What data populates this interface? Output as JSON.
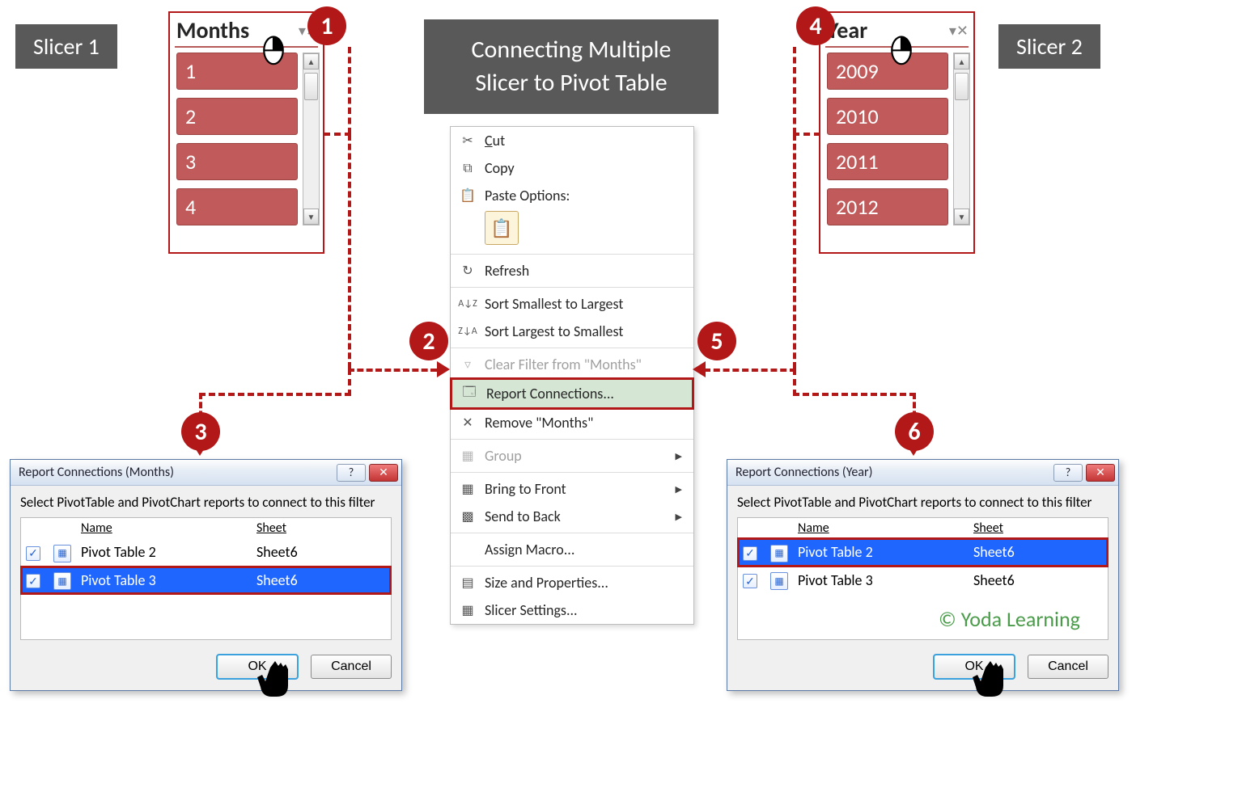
{
  "title_line1": "Connecting Multiple",
  "title_line2": "Slicer to Pivot Table",
  "label_slicer1": "Slicer 1",
  "label_slicer2": "Slicer 2",
  "watermark": "© Yoda Learning",
  "badges": {
    "b1": "1",
    "b2": "2",
    "b3": "3",
    "b4": "4",
    "b5": "5",
    "b6": "6"
  },
  "slicer1": {
    "title": "Months",
    "items": [
      "1",
      "2",
      "3",
      "4"
    ]
  },
  "slicer2": {
    "title": "Year",
    "items": [
      "2009",
      "2010",
      "2011",
      "2012"
    ]
  },
  "contextMenu": {
    "cut": "Cut",
    "copy": "Copy",
    "pasteOptions": "Paste Options:",
    "refresh": "Refresh",
    "sortAZ": "Sort Smallest to Largest",
    "sortZA": "Sort Largest to Smallest",
    "clearFilter": "Clear Filter from \"Months\"",
    "reportConnections": "Report Connections...",
    "remove": "Remove \"Months\"",
    "group": "Group",
    "bringFront": "Bring to Front",
    "sendBack": "Send to Back",
    "assignMacro": "Assign Macro...",
    "sizeProps": "Size and Properties...",
    "slicerSettings": "Slicer Settings..."
  },
  "dialog1": {
    "title": "Report Connections (Months)",
    "instr": "Select PivotTable and PivotChart reports to connect to this filter",
    "colName": "Name",
    "colSheet": "Sheet",
    "rows": [
      {
        "name": "Pivot Table 2",
        "sheet": "Sheet6",
        "checked": true,
        "selected": false,
        "boxed": false
      },
      {
        "name": "Pivot Table 3",
        "sheet": "Sheet6",
        "checked": true,
        "selected": true,
        "boxed": true
      }
    ],
    "ok": "OK",
    "cancel": "Cancel"
  },
  "dialog2": {
    "title": "Report Connections (Year)",
    "instr": "Select PivotTable and PivotChart reports to connect to this filter",
    "colName": "Name",
    "colSheet": "Sheet",
    "rows": [
      {
        "name": "Pivot Table 2",
        "sheet": "Sheet6",
        "checked": true,
        "selected": true,
        "boxed": true
      },
      {
        "name": "Pivot Table 3",
        "sheet": "Sheet6",
        "checked": true,
        "selected": false,
        "boxed": false
      }
    ],
    "ok": "OK",
    "cancel": "Cancel"
  }
}
